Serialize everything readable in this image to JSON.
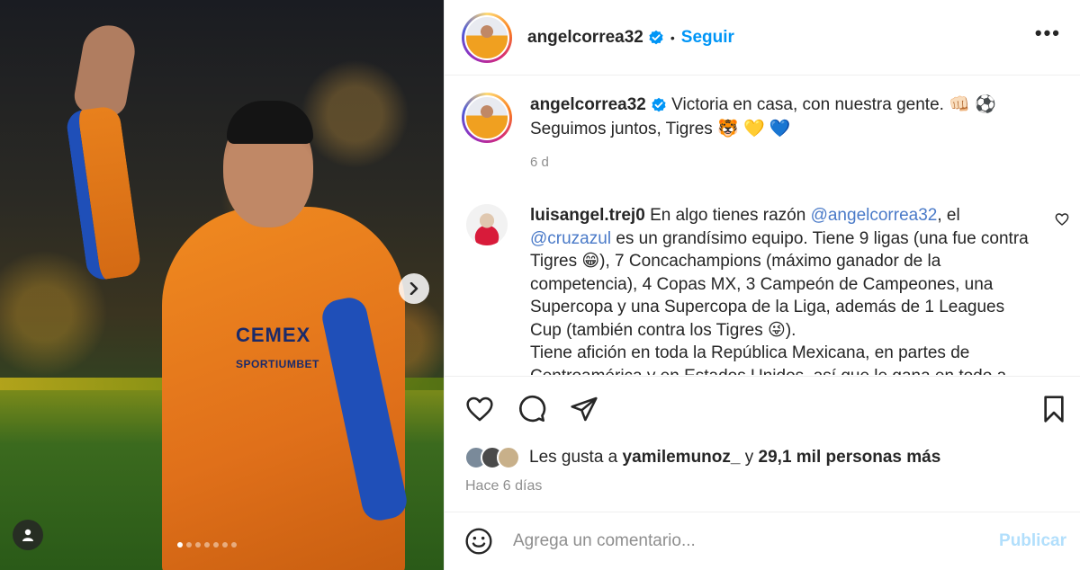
{
  "post": {
    "username": "angelcorrea32",
    "follow_label": "Seguir",
    "separator": "•",
    "more_label": "•••"
  },
  "caption": {
    "username": "angelcorrea32",
    "line1": "Victoria en casa, con nuestra gente. 👊🏻 ⚽",
    "line2": "Seguimos juntos, Tigres 🐯 💛 💙",
    "time": "6 d"
  },
  "comment": {
    "username": "luisangel.trej0",
    "text_a": "En algo tienes razón",
    "mention1": "@angelcorrea32",
    "text_b": ", el",
    "mention2": "@cruzazul",
    "text_c": "es un grandísimo equipo. Tiene 9 ligas (una fue contra Tigres 😁), 7 Concachampions (máximo ganador de la competencia), 4 Copas MX, 3 Campeón de Campeones, una Supercopa y una Supercopa de la Liga, además de 1 Leagues Cup (también contra los Tigres 😜).",
    "text_d": "Tiene afición en toda la República Mexicana, en partes de Centroamérica y en Estados Unidos, así que le gana en todo a"
  },
  "likes": {
    "prefix": "Les gusta a",
    "user": "yamilemunoz_",
    "connector": "y",
    "count_text": "29,1 mil personas más"
  },
  "time_ago": "Hace 6 días",
  "add_comment": {
    "placeholder": "Agrega un comentario...",
    "publish_label": "Publicar"
  },
  "media": {
    "jersey_brand": "CEMEX",
    "jersey_sponsor": "SPORTIUMBET",
    "carousel": {
      "total": 7,
      "active": 1
    }
  },
  "colors": {
    "accent": "#0095f6",
    "publish_disabled": "#b2dffc",
    "mention": "#4a7ac8",
    "muted": "#8e8e8e"
  }
}
